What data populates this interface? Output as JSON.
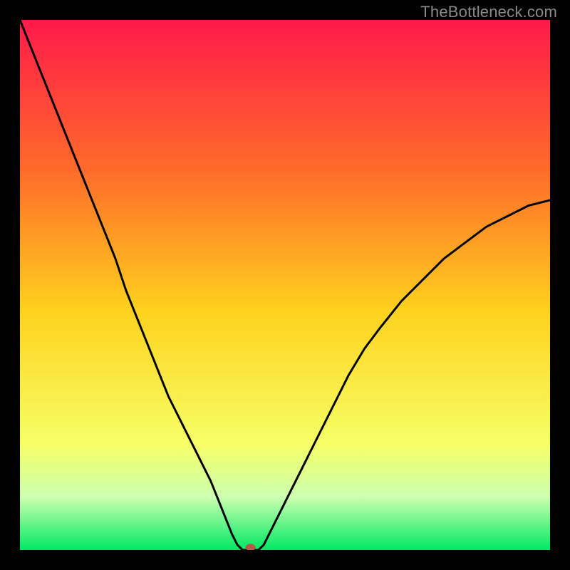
{
  "watermark": "TheBottleneck.com",
  "colors": {
    "gradient_top": "#ff1a4b",
    "gradient_upper": "#ff6a2a",
    "gradient_mid": "#ffd21e",
    "gradient_lower": "#f6ff66",
    "gradient_band": "#ccffb0",
    "gradient_bottom": "#00e864",
    "curve": "#000000",
    "marker": "#b65a4a",
    "frame": "#000000"
  },
  "chart_data": {
    "type": "line",
    "title": "",
    "xlabel": "",
    "ylabel": "",
    "xlim": [
      0,
      100
    ],
    "ylim": [
      0,
      100
    ],
    "x": [
      0,
      2,
      4,
      6,
      8,
      10,
      12,
      14,
      16,
      18,
      20,
      22,
      24,
      26,
      28,
      30,
      32,
      34,
      36,
      38,
      40,
      41,
      42,
      43,
      44,
      45,
      46,
      47,
      48,
      50,
      52,
      54,
      56,
      58,
      60,
      62,
      65,
      68,
      72,
      76,
      80,
      84,
      88,
      92,
      96,
      100
    ],
    "values": [
      100,
      95,
      90,
      85,
      80,
      75,
      70,
      65,
      60,
      55,
      49,
      44,
      39,
      34,
      29,
      25,
      21,
      17,
      13,
      8,
      3,
      1,
      0,
      0,
      0,
      0,
      1,
      3,
      5,
      9,
      13,
      17,
      21,
      25,
      29,
      33,
      38,
      42,
      47,
      51,
      55,
      58,
      61,
      63,
      65,
      66
    ],
    "marker": {
      "x": 43.5,
      "y": 0.5
    },
    "gradient_stops": [
      {
        "offset": 0.0,
        "color": "#ff1a4b"
      },
      {
        "offset": 0.28,
        "color": "#ff6a2a"
      },
      {
        "offset": 0.55,
        "color": "#ffd21e"
      },
      {
        "offset": 0.8,
        "color": "#f6ff66"
      },
      {
        "offset": 0.9,
        "color": "#ccffb0"
      },
      {
        "offset": 1.0,
        "color": "#00e864"
      }
    ]
  }
}
